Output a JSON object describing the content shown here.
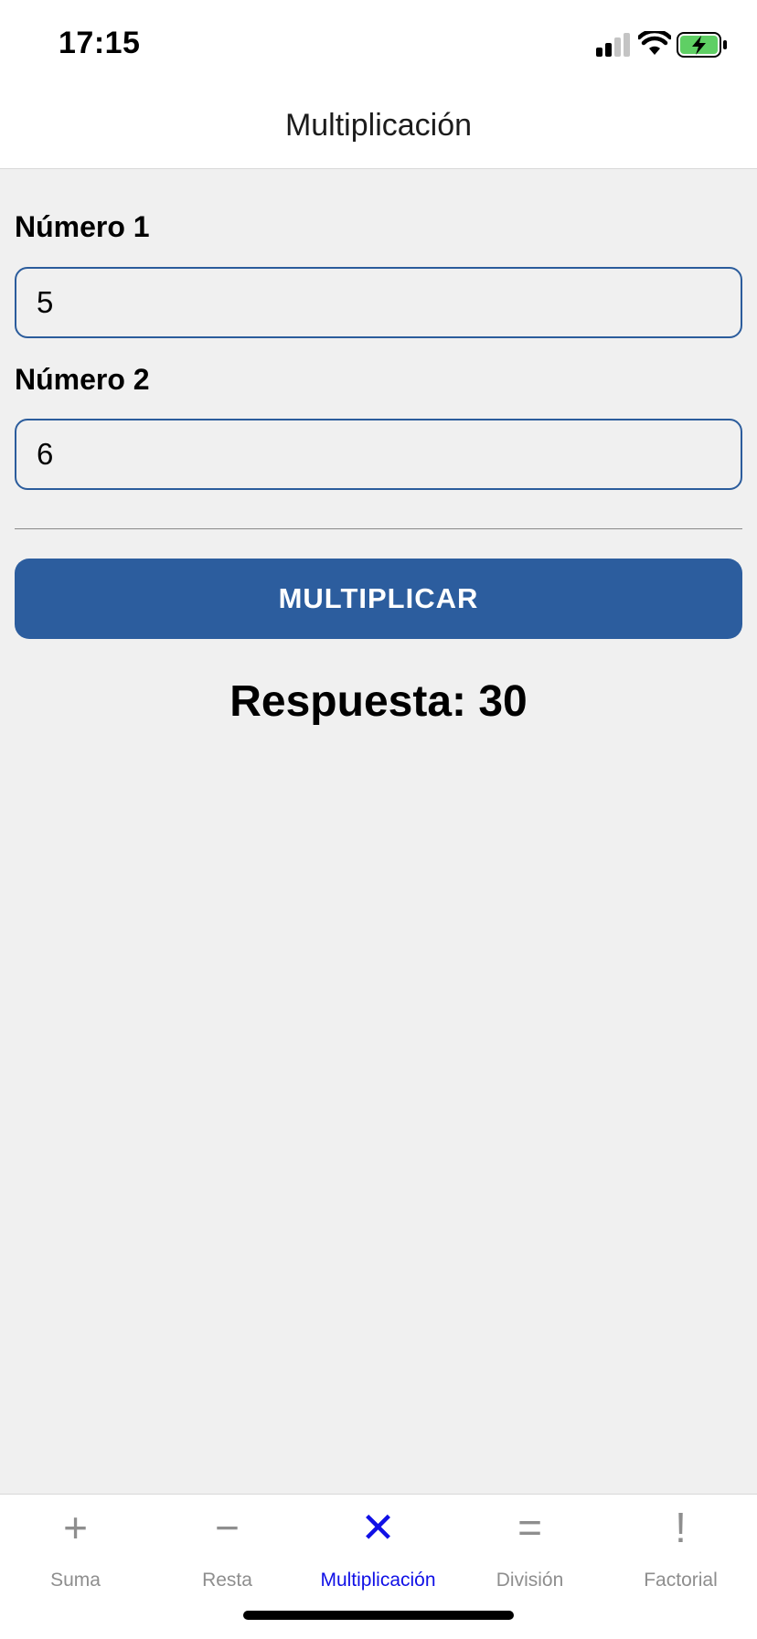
{
  "status_bar": {
    "time": "17:15",
    "icons": [
      "cellular-signal-icon",
      "wifi-icon",
      "battery-charging-icon"
    ]
  },
  "header": {
    "title": "Multiplicación"
  },
  "form": {
    "field1": {
      "label": "Número 1",
      "value": "5"
    },
    "field2": {
      "label": "Número 2",
      "value": "6"
    },
    "button_label": "MULTIPLICAR",
    "result": "Respuesta: 30"
  },
  "tabs": [
    {
      "label": "Suma",
      "icon": "plus-icon",
      "glyph": "+"
    },
    {
      "label": "Resta",
      "icon": "minus-icon",
      "glyph": "−"
    },
    {
      "label": "Multiplicación",
      "icon": "multiply-icon",
      "glyph": "✕",
      "active": true
    },
    {
      "label": "División",
      "icon": "equals-icon",
      "glyph": "="
    },
    {
      "label": "Factorial",
      "icon": "exclamation-icon",
      "glyph": "!"
    }
  ],
  "colors": {
    "accent": "#2c5d9e",
    "active_tab": "#1010e6",
    "inactive_tab": "#8e8e8e",
    "background": "#f0f0f0",
    "battery": "#5fcf64"
  }
}
